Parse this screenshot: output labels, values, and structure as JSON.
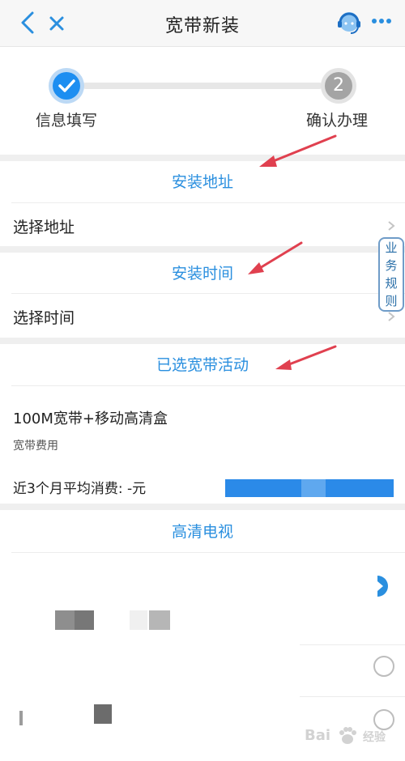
{
  "header": {
    "title": "宽带新装",
    "back_icon": "chevron-left-icon",
    "close_icon": "close-icon",
    "service_icon": "customer-service-icon",
    "more_icon": "more-dots-icon"
  },
  "steps": {
    "step1_label": "信息填写",
    "step2_number": "2",
    "step2_label": "确认办理",
    "current_step": 1
  },
  "address_section": {
    "title": "安装地址",
    "row_label": "选择地址"
  },
  "time_section": {
    "title": "安装时间",
    "row_label": "选择时间"
  },
  "side_tab": {
    "chars": [
      "业",
      "务",
      "规",
      "则"
    ]
  },
  "activity_section": {
    "title": "已选宽带活动",
    "package_name": "100M宽带+移动高清盒",
    "fee_label": "宽带费用",
    "avg_spend": "近3个月平均消费: -元"
  },
  "tv_section": {
    "title": "高清电视"
  },
  "watermark": {
    "brand": "Bai",
    "suffix": "经验"
  },
  "colors": {
    "accent": "#2a8fdf",
    "step_active": "#1d8ef1",
    "step_inactive": "#a4a4a4",
    "annotation_arrow": "#e0404f"
  }
}
